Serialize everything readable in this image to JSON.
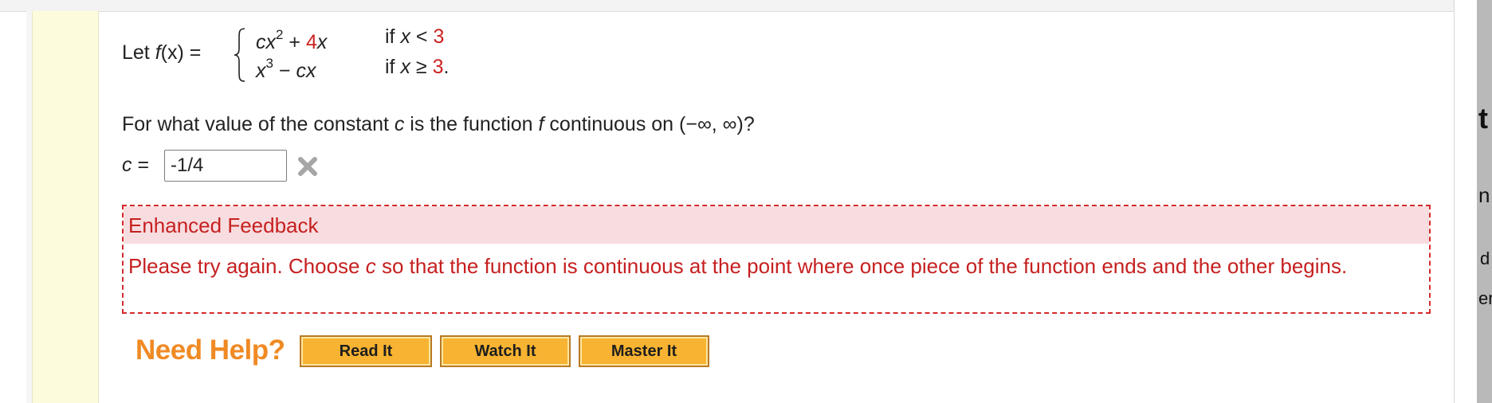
{
  "problem": {
    "let_prefix": "Let ",
    "func_name": "f",
    "func_arg": "(x)",
    "equals": " =",
    "piece1": {
      "expr_a": "cx",
      "expr_a_exp": "2",
      "expr_b": " + ",
      "expr_c": "4",
      "expr_d": "x",
      "cond_if": "if ",
      "cond_var": "x",
      "cond_op": " < ",
      "cond_val": "3",
      "cond_end": ""
    },
    "piece2": {
      "expr_a": "x",
      "expr_a_exp": "3",
      "expr_b": " − ",
      "expr_c": "",
      "expr_d": "cx",
      "cond_if": "if ",
      "cond_var": "x",
      "cond_op": " ≥ ",
      "cond_val": "3",
      "cond_end": "."
    },
    "question_pre": "For what value of the constant ",
    "question_var": "c",
    "question_mid": " is the function ",
    "question_func": "f",
    "question_post": " continuous on (−∞, ∞)?"
  },
  "answer": {
    "label_var": "c",
    "label_eq": " =",
    "value": "-1/4",
    "status_icon": "x-mark-icon",
    "status_color": "#a6a6a6"
  },
  "feedback": {
    "title": "Enhanced Feedback",
    "body_pre": "Please try again. Choose ",
    "body_var": "c",
    "body_post": " so that the function is continuous at the point where once piece of the function ends and the other begins.",
    "border_color": "#d42b2b",
    "header_bg": "#f8dde0",
    "text_color": "#c62020"
  },
  "help": {
    "label": "Need Help?",
    "buttons": [
      "Read It",
      "Watch It",
      "Master It"
    ],
    "label_color": "#f08a24",
    "button_color": "#f7b331"
  },
  "right_edge_fragments": [
    "t",
    "n",
    "d",
    "er"
  ]
}
